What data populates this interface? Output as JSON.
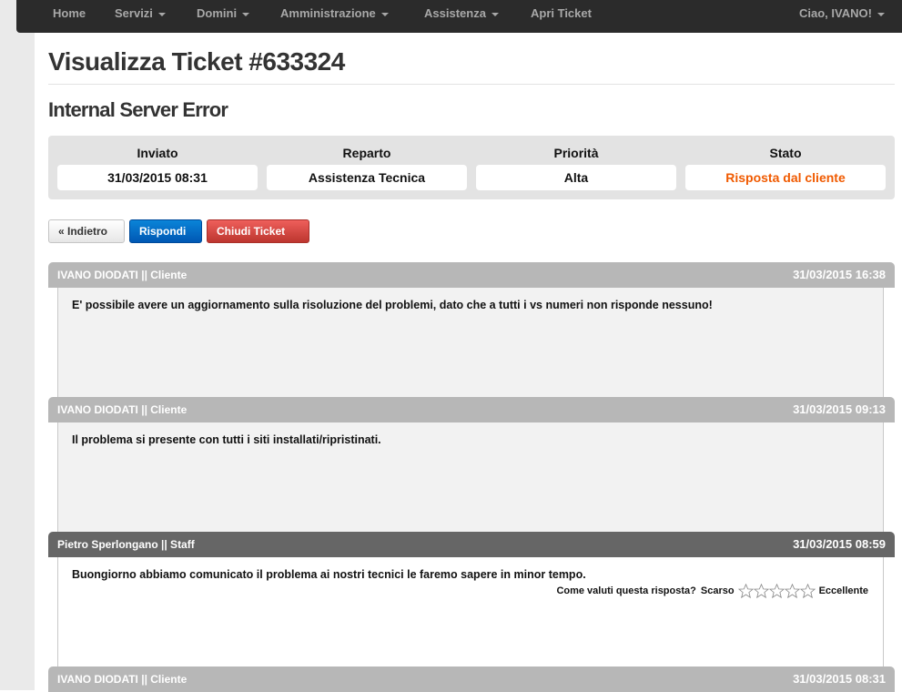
{
  "nav": {
    "home": "Home",
    "servizi": "Servizi",
    "domini": "Domini",
    "amministrazione": "Amministrazione",
    "assistenza": "Assistenza",
    "apri_ticket": "Apri Ticket",
    "user": "Ciao, IVANO!"
  },
  "page": {
    "title": "Visualizza Ticket #633324",
    "subject": "Internal Server Error"
  },
  "ticket_info": {
    "inviato_label": "Inviato",
    "inviato_value": "31/03/2015 08:31",
    "reparto_label": "Reparto",
    "reparto_value": "Assistenza Tecnica",
    "priorita_label": "Priorità",
    "priorita_value": "Alta",
    "stato_label": "Stato",
    "stato_value": "Risposta dal cliente",
    "stato_color": "#f05a00"
  },
  "buttons": {
    "back": "« Indietro",
    "reply": "Rispondi",
    "close": "Chiudi Ticket"
  },
  "replies": [
    {
      "author": "IVANO DIODATI || Cliente",
      "date": "31/03/2015 16:38",
      "text": "E' possibile avere un aggiornamento sulla risoluzione del problemi, dato che a tutti i vs numeri non risponde nessuno!"
    },
    {
      "author": "IVANO DIODATI || Cliente",
      "date": "31/03/2015 09:13",
      "text": "Il problema si presente con tutti i siti installati/ripristinati."
    },
    {
      "author": "Pietro Sperlongano || Staff",
      "date": "31/03/2015 08:59",
      "text": "Buongiorno abbiamo comunicato il problema ai nostri tecnici le faremo sapere in minor tempo.",
      "rating_question": "Come valuti questa risposta?",
      "rating_low": "Scarso",
      "rating_high": "Eccellente"
    },
    {
      "author": "IVANO DIODATI || Cliente",
      "date": "31/03/2015 08:31"
    }
  ]
}
